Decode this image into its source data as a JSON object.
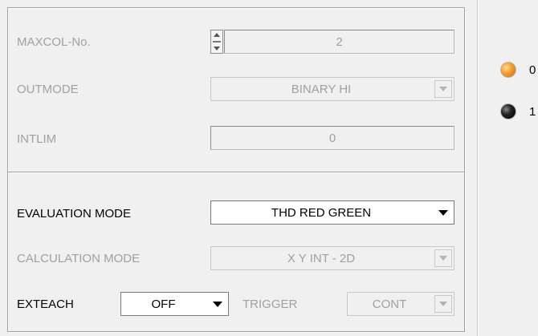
{
  "settings_panel": {
    "maxcol": {
      "label": "MAXCOL-No.",
      "value": "2"
    },
    "outmode": {
      "label": "OUTMODE",
      "value": "BINARY HI"
    },
    "intlim": {
      "label": "INTLIM",
      "value": "0"
    }
  },
  "evaluation_panel": {
    "evaluation_mode": {
      "label": "EVALUATION MODE",
      "value": "THD RED GREEN"
    },
    "calculation_mode": {
      "label": "CALCULATION MODE",
      "value": "X Y INT - 2D"
    },
    "exteach": {
      "label": "EXTEACH",
      "value": "OFF"
    },
    "trigger": {
      "label": "TRIGGER",
      "value": "CONT"
    }
  },
  "status_leds": [
    {
      "label": "0",
      "color": "#f39b2b",
      "state": "orange"
    },
    {
      "label": "1",
      "color": "#111111",
      "state": "black"
    }
  ]
}
